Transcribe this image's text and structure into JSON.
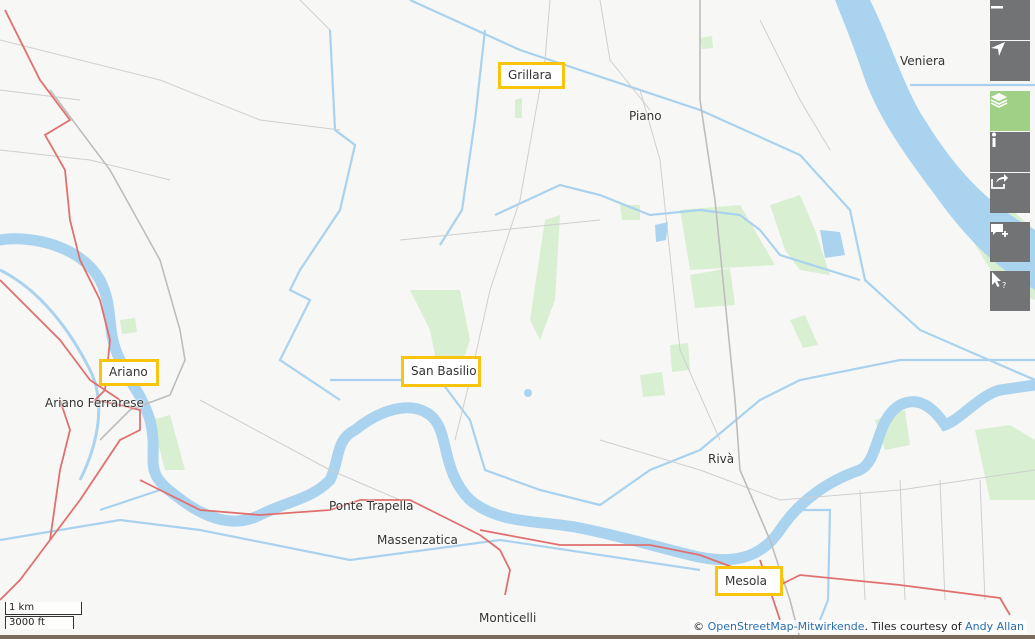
{
  "map": {
    "places": {
      "veniera": "Veniera",
      "piano": "Piano",
      "ariano_ferrarese": "Ariano Ferrarese",
      "riva": "Rivà",
      "ponte_trapella": "Ponte Trapella",
      "massenzatica": "Massenzatica",
      "monticelli": "Monticelli"
    },
    "highlighted": {
      "grillara": "Grillara",
      "ariano": "Ariano",
      "san_basilio": "San Basilio",
      "mesola": "Mesola"
    },
    "highlight_color": "#f8c40d",
    "water_color": "#aad3f0",
    "boundary_color": "#e07070"
  },
  "controls": [
    {
      "name": "zoom-out",
      "icon": "minus-icon"
    },
    {
      "name": "locate",
      "icon": "location-arrow-icon"
    },
    {
      "name": "layers",
      "icon": "layers-icon",
      "active": true
    },
    {
      "name": "info",
      "icon": "info-icon"
    },
    {
      "name": "share",
      "icon": "share-icon"
    },
    {
      "name": "add-note",
      "icon": "comment-plus-icon"
    },
    {
      "name": "query",
      "icon": "pointer-question-icon"
    }
  ],
  "scale": {
    "metric": "1 km",
    "imperial": "3000 ft"
  },
  "attribution": {
    "prefix": "© ",
    "osm_link": "OpenStreetMap-Mitwirkende",
    "middle": ". Tiles courtesy of ",
    "author_link": "Andy Allan"
  }
}
